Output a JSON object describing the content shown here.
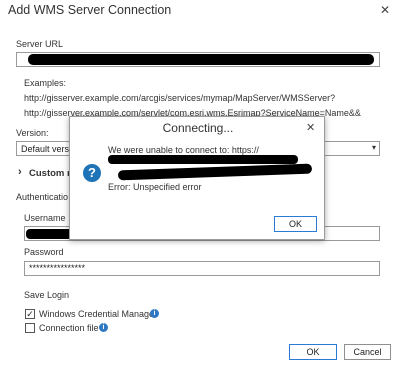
{
  "window": {
    "title": "Add WMS Server Connection",
    "close_glyph": "✕"
  },
  "server_url": {
    "label": "Server URL",
    "value": ""
  },
  "examples": {
    "heading": "Examples:",
    "line1": "http://gisserver.example.com/arcgis/services/mymap/MapServer/WMSServer?",
    "line2": "http://gisserver.example.com/servlet/com.esri.wms.Esrimap?ServiceName=Name&&"
  },
  "version": {
    "label": "Version:",
    "selected": "Default version"
  },
  "custom_request": {
    "chevron": "›",
    "label": "Custom re"
  },
  "authentication": {
    "label": "Authenticatio"
  },
  "username": {
    "label": "Username",
    "value": ""
  },
  "password": {
    "label": "Password",
    "value": "****************"
  },
  "save_login": {
    "label": "Save Login",
    "windows_credential_manager": {
      "label": "Windows Credential Manager",
      "checked": true,
      "mark": "✓"
    },
    "connection_file": {
      "label": "Connection file",
      "checked": false,
      "mark": ""
    }
  },
  "footer": {
    "ok_label": "OK",
    "cancel_label": "Cancel"
  },
  "dialog": {
    "title": "Connecting...",
    "close_glyph": "✕",
    "message": "We were unable to connect to: https://",
    "error": "Error: Unspecified error",
    "ok_label": "OK",
    "icon_glyph": "?"
  },
  "colors": {
    "accent": "#2a7bd4",
    "info": "#2f78c4",
    "question": "#1f73b7"
  }
}
